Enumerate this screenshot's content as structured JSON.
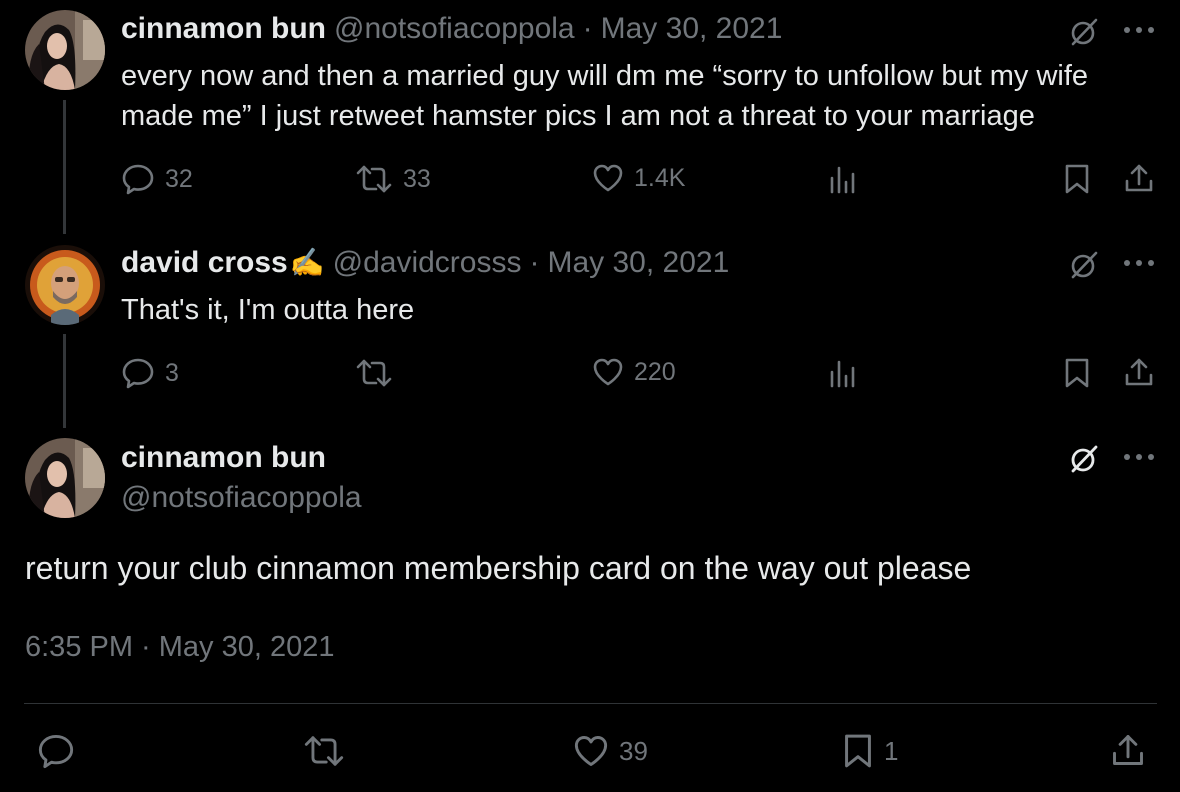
{
  "tweet1": {
    "display_name": "cinnamon bun",
    "handle": "@notsofiacoppola",
    "separator": "·",
    "date": "May 30, 2021",
    "text": "every now and then a married guy will dm me “sorry to unfollow but my wife made me” I just retweet hamster pics I am not a threat to your marriage",
    "replies": "32",
    "retweets": "33",
    "likes": "1.4K"
  },
  "tweet2": {
    "display_name": "david cross",
    "name_emoji": "✍️",
    "handle": "@davidcrosss",
    "separator": "·",
    "date": "May 30, 2021",
    "text": "That's it, I'm outta here",
    "replies": "3",
    "retweets": "",
    "likes": "220"
  },
  "main_tweet": {
    "display_name": "cinnamon bun",
    "handle": "@notsofiacoppola",
    "text": "return your club cinnamon membership card on the way out please",
    "timestamp": "6:35 PM · May 30, 2021",
    "likes": "39",
    "bookmarks": "1"
  },
  "colors": {
    "background": "#000000",
    "primary_text": "#e7e9ea",
    "secondary_text": "#71767b",
    "thread_line": "#333639",
    "divider": "#2f3336"
  }
}
